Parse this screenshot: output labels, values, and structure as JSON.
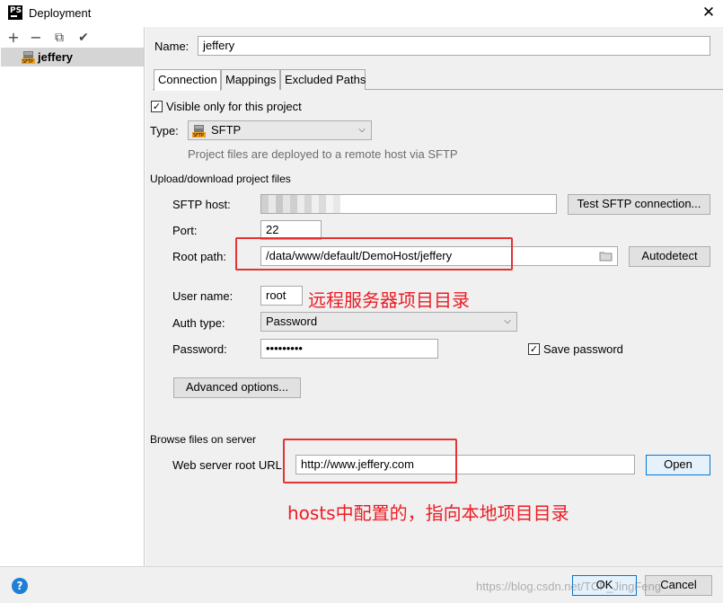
{
  "window": {
    "app_icon_text": "PS",
    "title": "Deployment",
    "close_glyph": "✕"
  },
  "toolbar": {
    "add": "+",
    "remove": "−",
    "copy": "⧉",
    "apply": "✔"
  },
  "servers": [
    {
      "name": "jeffery",
      "icon": "sftp-icon",
      "selected": true
    }
  ],
  "name_field": {
    "label": "Name:",
    "value": "jeffery"
  },
  "tabs": [
    {
      "label": "Connection",
      "active": true
    },
    {
      "label": "Mappings",
      "active": false
    },
    {
      "label": "Excluded Paths",
      "active": false
    }
  ],
  "visible_only": {
    "label": "Visible only for this project",
    "checked": true,
    "check_glyph": "✓"
  },
  "type_field": {
    "label": "Type:",
    "value": "SFTP",
    "hint": "Project files are deployed to a remote host via SFTP"
  },
  "upload_section": {
    "title": "Upload/download project files",
    "sftp_host_label": "SFTP host:",
    "sftp_host_value": "",
    "test_button": "Test SFTP connection...",
    "port_label": "Port:",
    "port_value": "22",
    "root_path_label": "Root path:",
    "root_path_value": "/data/www/default/DemoHost/jeffery",
    "autodetect_button": "Autodetect",
    "username_label": "User name:",
    "username_value": "root",
    "auth_type_label": "Auth type:",
    "auth_type_value": "Password",
    "password_label": "Password:",
    "password_value": "•••••••••",
    "save_password_label": "Save password",
    "save_password_checked": true,
    "advanced_button": "Advanced options..."
  },
  "browse_section": {
    "title": "Browse files on server",
    "web_root_label": "Web server root URL:",
    "web_root_value": "http://www.jeffery.com",
    "open_button": "Open"
  },
  "annotations": {
    "root_path_note": "远程服务器项目目录",
    "url_note": "hosts中配置的，指向本地项目目录"
  },
  "footer": {
    "help": "?",
    "ok_button": "OK",
    "cancel_button": "Cancel",
    "watermark": "https://blog.csdn.net/TCF_JingFeng"
  },
  "colors": {
    "annotation_red": "#ec1c24",
    "primary_blue": "#0078d7",
    "help_blue": "#1e7fd6"
  }
}
